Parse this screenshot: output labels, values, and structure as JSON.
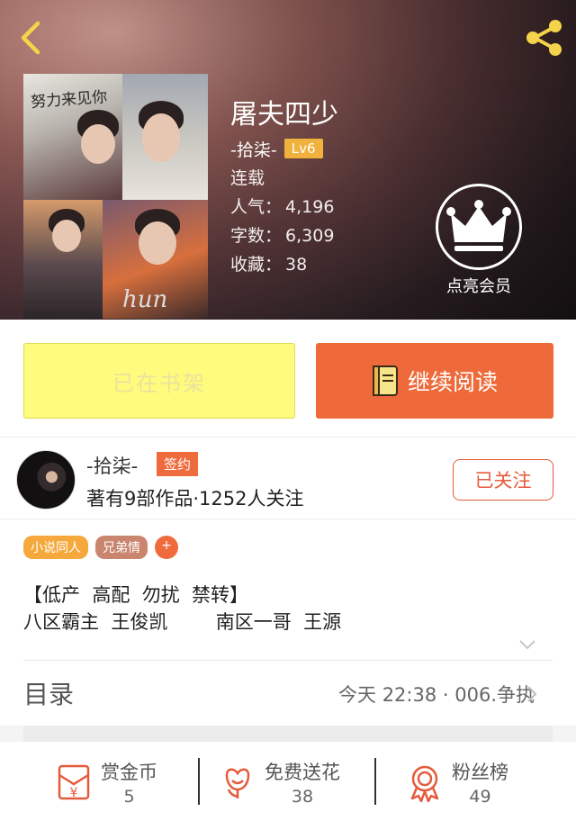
{
  "header": {
    "book_title": "屠夫四少",
    "author_name": "-拾柒-",
    "author_level": "Lv6",
    "status": "连载",
    "stats": [
      {
        "label": "人气：",
        "value": "4,196"
      },
      {
        "label": "字数：",
        "value": "6,309"
      },
      {
        "label": "收藏：",
        "value": "38"
      }
    ],
    "vip_label": "点亮会员",
    "cover": {
      "title_text": "努力来见你",
      "signature_text": "hun"
    }
  },
  "actions": {
    "shelf_label": "已在书架",
    "read_label": "继续阅读"
  },
  "author": {
    "name": "-拾柒-",
    "badge": "签约",
    "info": "著有9部作品·1252人关注",
    "follow_label": "已关注"
  },
  "tags": [
    "小说同人",
    "兄弟情",
    "+"
  ],
  "description": {
    "line1": "【低产  高配  勿扰  禁转】",
    "line2": "八区霸主  王俊凯        南区一哥  王源"
  },
  "toc": {
    "label": "目录",
    "latest": "今天 22:38 · 006.争执"
  },
  "bottom_bar": [
    {
      "label": "赏金币",
      "value": "5",
      "icon": "reward-coin-icon"
    },
    {
      "label": "免费送花",
      "value": "38",
      "icon": "flower-icon"
    },
    {
      "label": "粉丝榜",
      "value": "49",
      "icon": "ribbon-medal-icon"
    }
  ],
  "colors": {
    "accent": "#ee6a3b",
    "shelf_bg": "#fffb7c",
    "level_badge": "#f0b23c",
    "tag_orange": "#f5a93d",
    "tag_brown": "#c9856e"
  }
}
